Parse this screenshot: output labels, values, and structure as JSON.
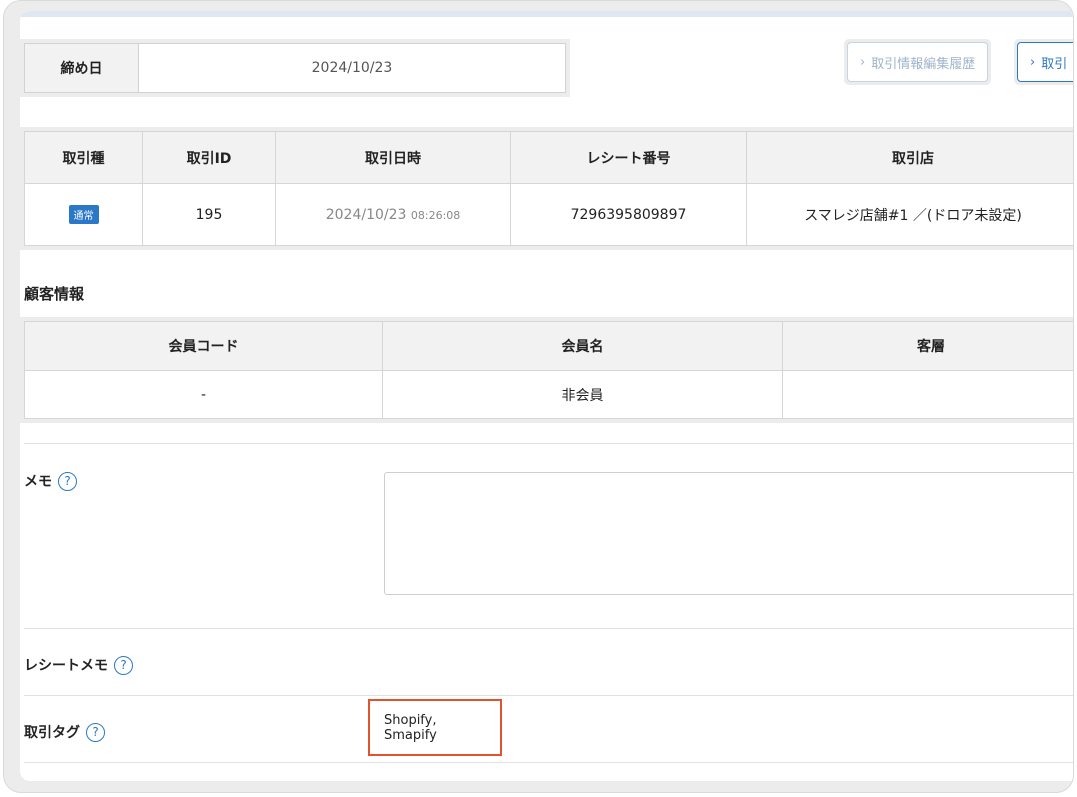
{
  "closing": {
    "label": "締め日",
    "value": "2024/10/23"
  },
  "buttons": {
    "edit_history": "取引情報編集履歴",
    "next_partial": "取引"
  },
  "transaction": {
    "headers": [
      "取引種",
      "取引ID",
      "取引日時",
      "レシート番号",
      "取引店"
    ],
    "type_badge": "通常",
    "id": "195",
    "date": "2024/10/23",
    "time": "08:26:08",
    "receipt_no": "7296395809897",
    "store": "スマレジ店舗#1 ／(ドロア未設定)"
  },
  "customer": {
    "title": "顧客情報",
    "headers": [
      "会員コード",
      "会員名",
      "客層"
    ],
    "code": "-",
    "name": "非会員",
    "segment": ""
  },
  "memo": {
    "label": "メモ",
    "value": ""
  },
  "receipt_memo": {
    "label": "レシートメモ"
  },
  "tags": {
    "label": "取引タグ",
    "value": "Shopify, Smapify"
  },
  "icons": {
    "help": "help-circle-icon",
    "chevron": "chevron-right-icon"
  }
}
